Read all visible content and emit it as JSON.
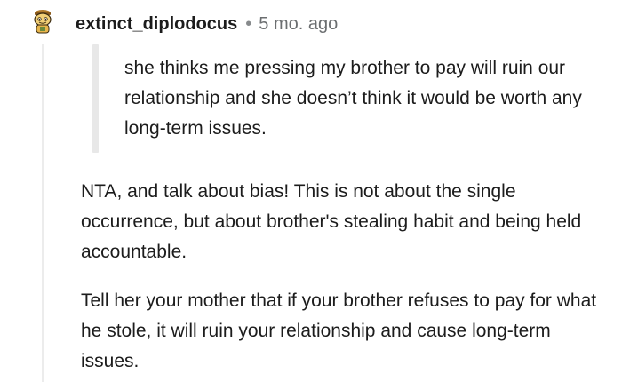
{
  "comment": {
    "username": "extinct_diplodocus",
    "separator": "•",
    "timestamp": "5 mo. ago",
    "quote": "she thinks me pressing my brother to pay will ruin our relationship and she doesn’t think it would be worth any long-term issues.",
    "paragraphs": [
      "NTA, and talk about bias! This is not about the single occurrence, but about brother's stealing habit and being held accountable.",
      "Tell her your mother that if your brother refuses to pay for what he stole, it will ruin your relationship and cause long-term issues."
    ]
  },
  "colors": {
    "username": "#1c1c1c",
    "timestamp": "#6b6e70",
    "quote_bar": "#e8e8e8",
    "thread_line": "#ececec",
    "avatar_primary": "#e8b64c"
  },
  "icons": {
    "avatar": "reddit-snoo-avatar-icon"
  }
}
